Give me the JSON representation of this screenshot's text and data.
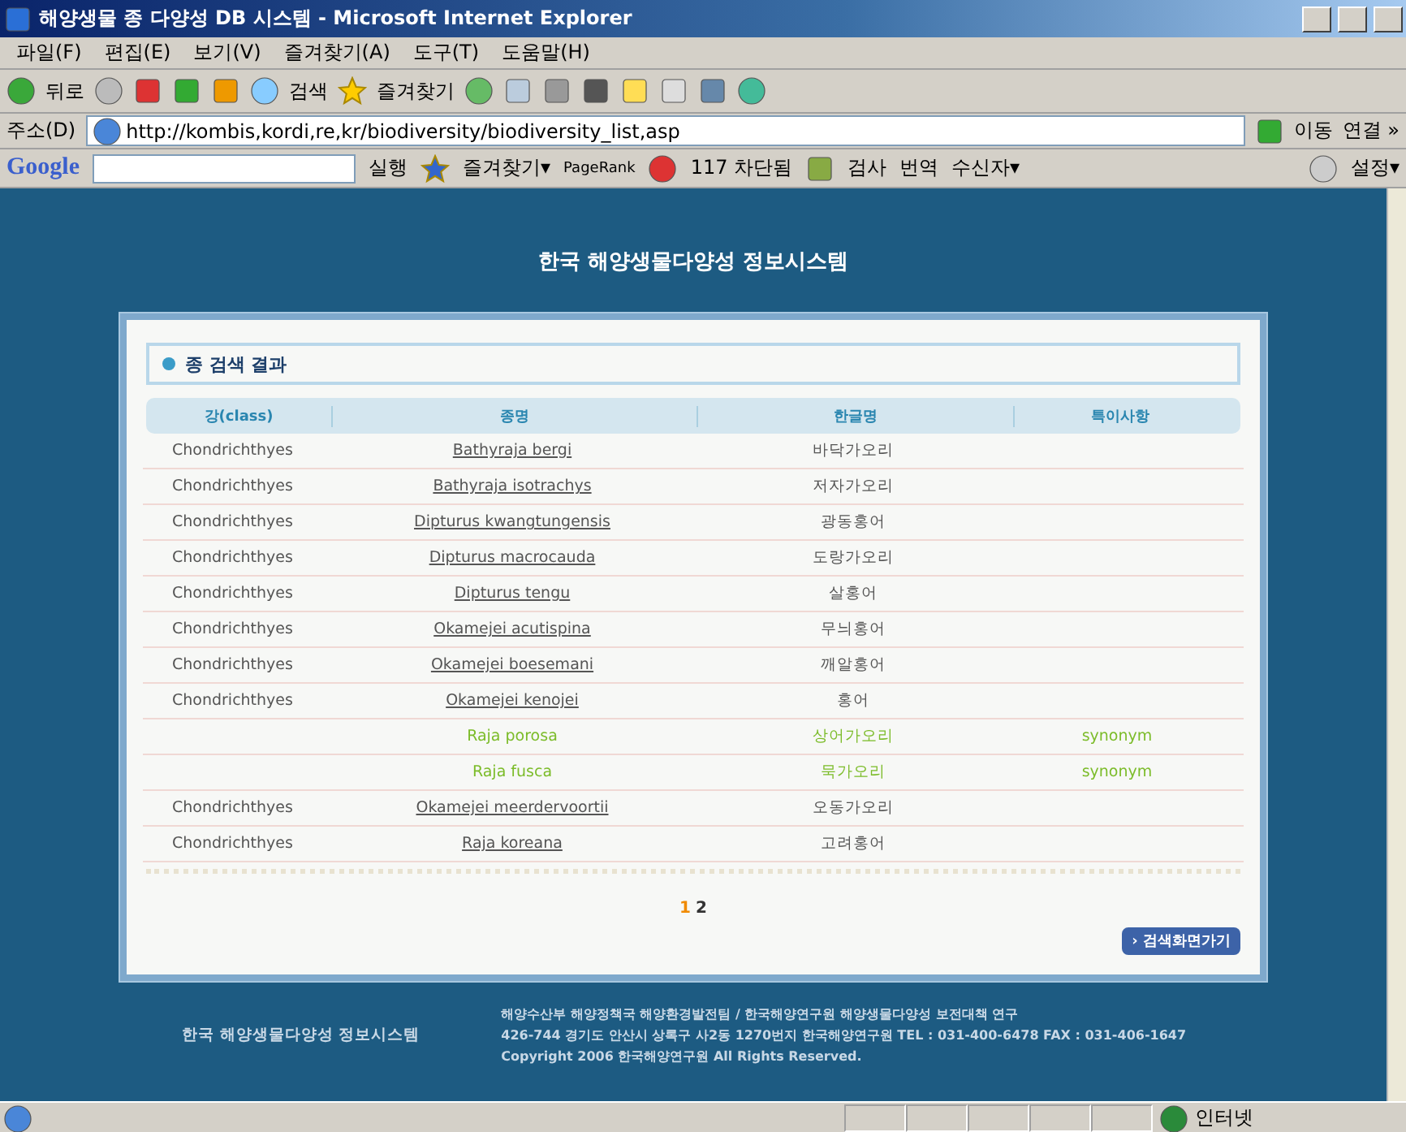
{
  "window": {
    "title": "해양생물 종 다양성 DB 시스템 - Microsoft Internet Explorer"
  },
  "menu": [
    "파일(F)",
    "편집(E)",
    "보기(V)",
    "즐겨찾기(A)",
    "도구(T)",
    "도움말(H)"
  ],
  "toolbar": {
    "back": "뒤로",
    "search": "검색",
    "favorites": "즐겨찾기"
  },
  "address": {
    "label": "주소(D)",
    "url": "http://kombis,kordi,re,kr/biodiversity/biodiversity_list,asp",
    "go": "이동",
    "links": "연결 »"
  },
  "google_bar": {
    "logo": "Google",
    "run": "실행",
    "favorites": "즐겨찾기▾",
    "pagerank": "PageRank",
    "blocked": "117 차단됨",
    "check": "검사",
    "translate": "번역",
    "sender": "수신자▾",
    "settings": "설정▾"
  },
  "page": {
    "site_title": "한국 해양생물다양성 정보시스템",
    "section_title": "종 검색 결과",
    "columns": [
      "강(class)",
      "종명",
      "한글명",
      "특이사항"
    ],
    "rows": [
      {
        "kind": "species",
        "class": "Chondrichthyes",
        "species": "Bathyraja bergi",
        "korean": "바닥가오리"
      },
      {
        "kind": "species",
        "class": "Chondrichthyes",
        "species": "Bathyraja isotrachys",
        "korean": "저자가오리"
      },
      {
        "kind": "species",
        "class": "Chondrichthyes",
        "species": "Dipturus kwangtungensis",
        "korean": "광동홍어"
      },
      {
        "kind": "species",
        "class": "Chondrichthyes",
        "species": "Dipturus macrocauda",
        "korean": "도랑가오리"
      },
      {
        "kind": "species",
        "class": "Chondrichthyes",
        "species": "Dipturus tengu",
        "korean": "살홍어"
      },
      {
        "kind": "species",
        "class": "Chondrichthyes",
        "species": "Okamejei acutispina",
        "korean": "무늬홍어"
      },
      {
        "kind": "species",
        "class": "Chondrichthyes",
        "species": "Okamejei boesemani",
        "korean": "깨알홍어"
      },
      {
        "kind": "species",
        "class": "Chondrichthyes",
        "species": "Okamejei kenojei",
        "korean": "홍어"
      },
      {
        "kind": "synonym",
        "species": "Raja porosa",
        "korean": "상어가오리",
        "note": "synonym"
      },
      {
        "kind": "synonym",
        "species": "Raja fusca",
        "korean": "묵가오리",
        "note": "synonym"
      },
      {
        "kind": "species",
        "class": "Chondrichthyes",
        "species": "Okamejei meerdervoortii",
        "korean": "오동가오리"
      },
      {
        "kind": "species",
        "class": "Chondrichthyes",
        "species": "Raja koreana",
        "korean": "고려홍어"
      }
    ],
    "pages": [
      {
        "label": "1",
        "selected": true
      },
      {
        "label": "2",
        "selected": false
      }
    ],
    "back_button": "› 검색화면가기",
    "footer": {
      "site": "한국 해양생물다양성 정보시스템",
      "lines": [
        "해양수산부 해양정책국 해양환경발전팀 / 한국해양연구원 해양생물다양성 보전대책 연구",
        "426-744 경기도 안산시 상록구 사2동 1270번지 한국해양연구원  TEL : 031-400-6478  FAX : 031-406-1647",
        "Copyright 2006 한국해양연구원 All Rights Reserved."
      ]
    }
  },
  "status_bar": {
    "zone": "인터넷"
  }
}
